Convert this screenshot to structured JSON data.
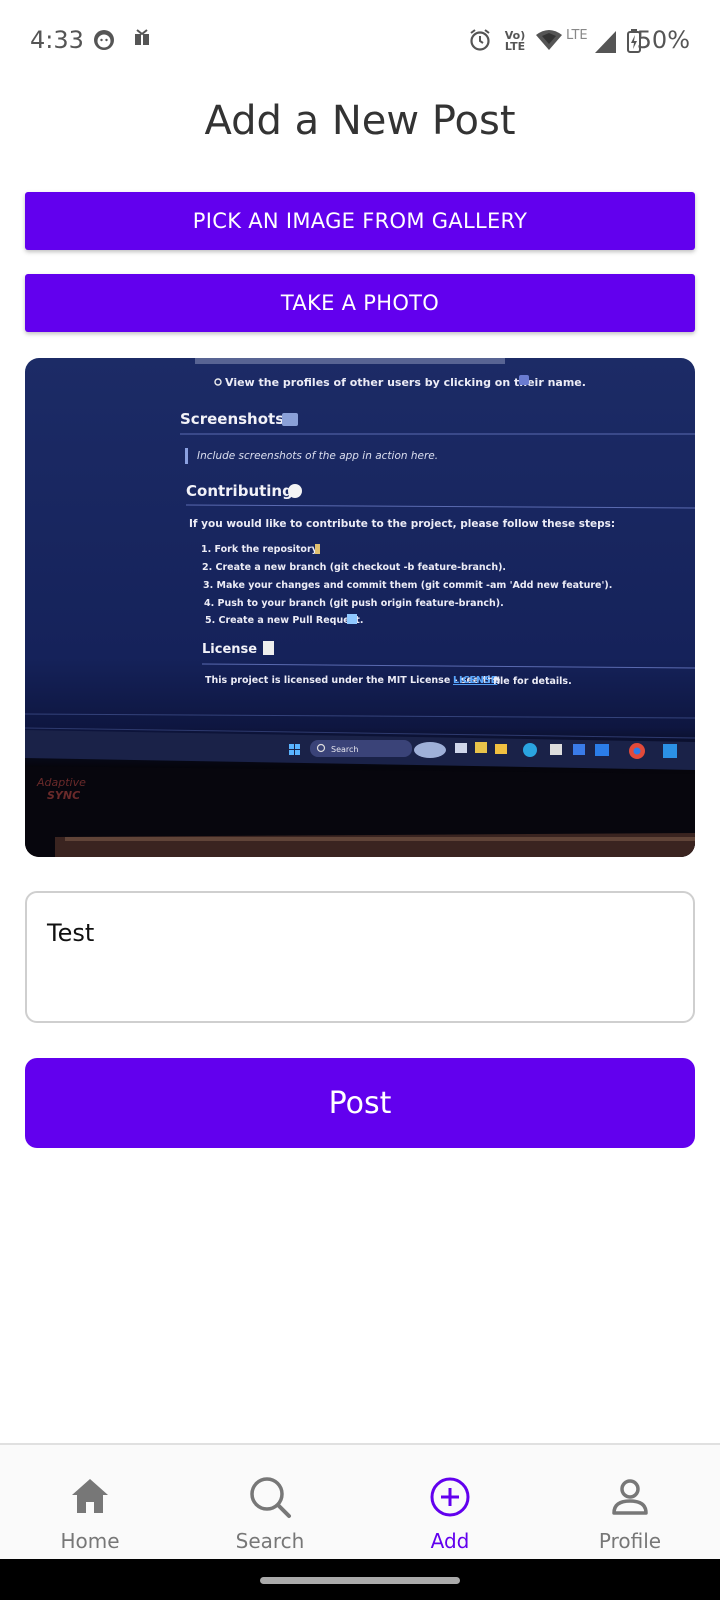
{
  "status_bar": {
    "time": "4:33",
    "network_text": "Vo) LTE",
    "lte_label": "LTE",
    "battery": "50%",
    "icons": [
      "face-icon",
      "gift-icon",
      "alarm-icon",
      "volte-icon",
      "wifi-icon",
      "signal-icon",
      "battery-icon"
    ]
  },
  "page": {
    "title": "Add a New Post"
  },
  "actions": {
    "gallery_label": "PICK AN IMAGE FROM GALLERY",
    "photo_label": "TAKE A PHOTO"
  },
  "preview": {
    "line_profiles": "View the profiles of other users by clicking on their name.",
    "h_screenshots": "Screenshots",
    "quote": "Include screenshots of the app in action here.",
    "h_contributing": "Contributing",
    "contrib_intro": "If you would like to contribute to the project, please follow these steps:",
    "steps": [
      "1. Fork the repository.",
      "2. Create a new branch (git checkout -b feature-branch).",
      "3. Make your changes and commit them (git commit -am 'Add new feature').",
      "4. Push to your branch (git push origin feature-branch).",
      "5. Create a new Pull Request."
    ],
    "h_license": "License",
    "license_text": "This project is licensed under the MIT License - see the",
    "license_link": "LICENSE",
    "license_tail": "file for details.",
    "taskbar_search": "Search",
    "monitor_brand_1": "Adaptive",
    "monitor_brand_2": "SYNC"
  },
  "caption_input": {
    "value": "Test"
  },
  "post_button": {
    "label": "Post"
  },
  "bottom_nav": {
    "items": [
      {
        "label": "Home",
        "icon": "home-icon"
      },
      {
        "label": "Search",
        "icon": "search-icon"
      },
      {
        "label": "Add",
        "icon": "add-circle-icon",
        "active": true
      },
      {
        "label": "Profile",
        "icon": "person-icon"
      }
    ]
  },
  "colors": {
    "accent": "#6200ee",
    "inactive": "#777777"
  }
}
